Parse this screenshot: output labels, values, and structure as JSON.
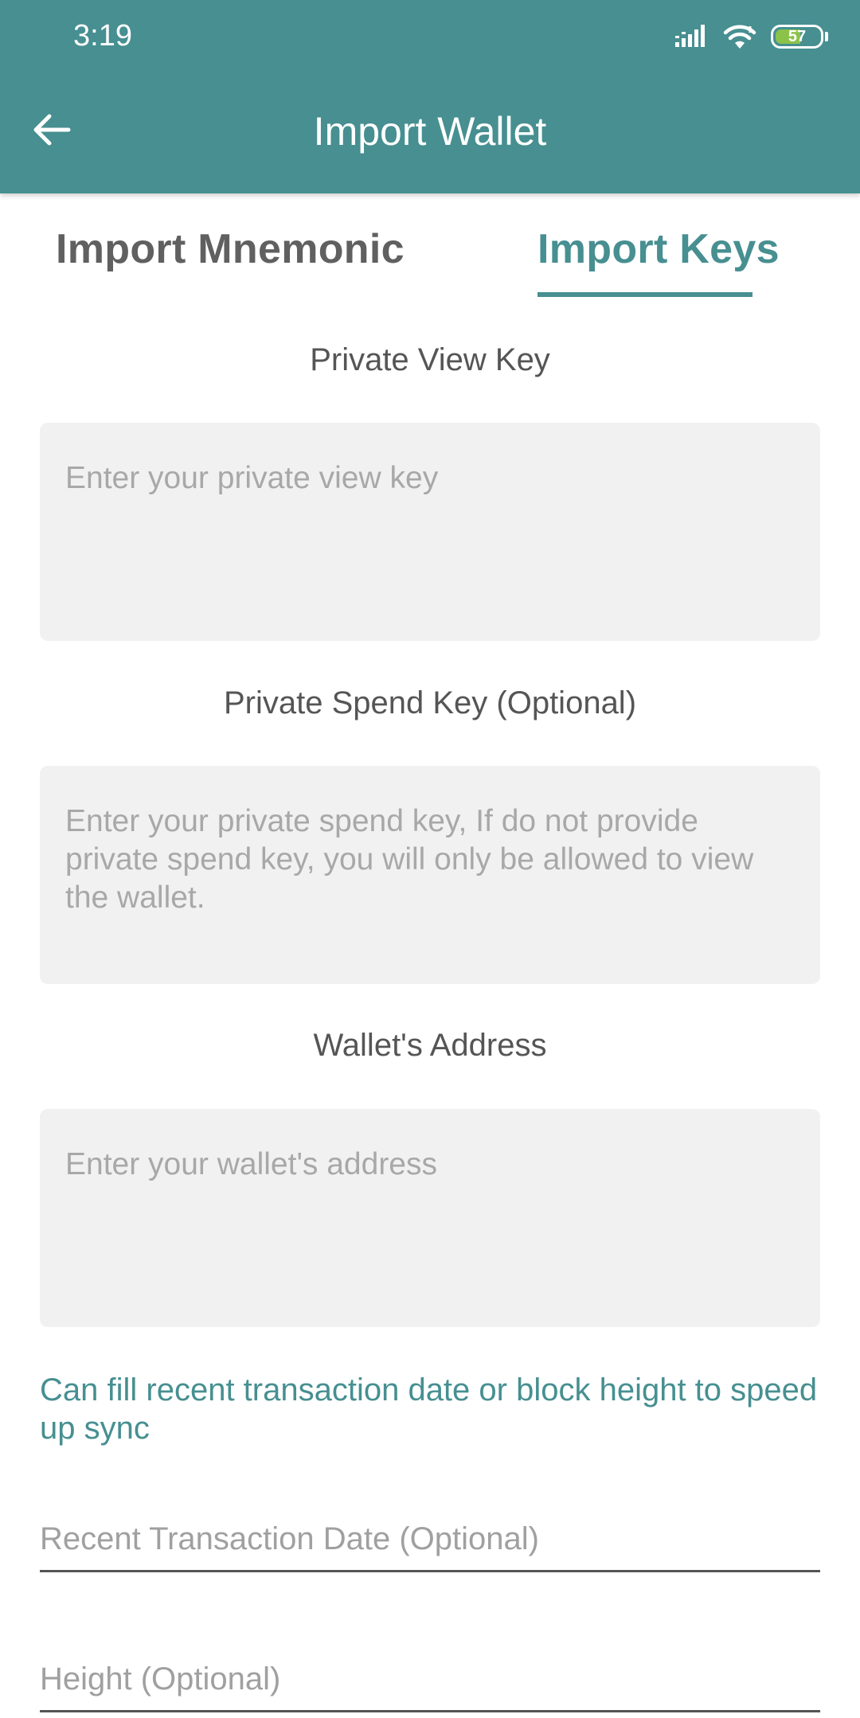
{
  "status_bar": {
    "time": "3:19",
    "battery_level": "57",
    "icons": [
      "signal-icon",
      "wifi-icon",
      "battery-icon"
    ]
  },
  "app_bar": {
    "title": "Import Wallet",
    "back_icon": "back-arrow-icon",
    "color": "#478f91"
  },
  "tabs": [
    {
      "label": "Import Mnemonic",
      "active": false
    },
    {
      "label": "Import Keys",
      "active": true
    }
  ],
  "form": {
    "private_view_key": {
      "label": "Private View Key",
      "placeholder": "Enter your private view key",
      "value": ""
    },
    "private_spend_key": {
      "label": "Private Spend Key (Optional)",
      "placeholder": "Enter your private spend key, If do not provide private spend key, you will only be allowed to view the wallet.",
      "value": ""
    },
    "wallet_address": {
      "label": "Wallet's Address",
      "placeholder": "Enter your wallet's address",
      "value": ""
    },
    "sync_hint": "Can fill recent transaction date or block height to speed up sync",
    "recent_transaction_date": {
      "placeholder": "Recent Transaction Date (Optional)",
      "value": ""
    },
    "height": {
      "placeholder": "Height (Optional)",
      "value": ""
    }
  },
  "colors": {
    "accent": "#478f91",
    "input_background": "#f1f1f1",
    "battery_fill": "#8bc34a"
  }
}
